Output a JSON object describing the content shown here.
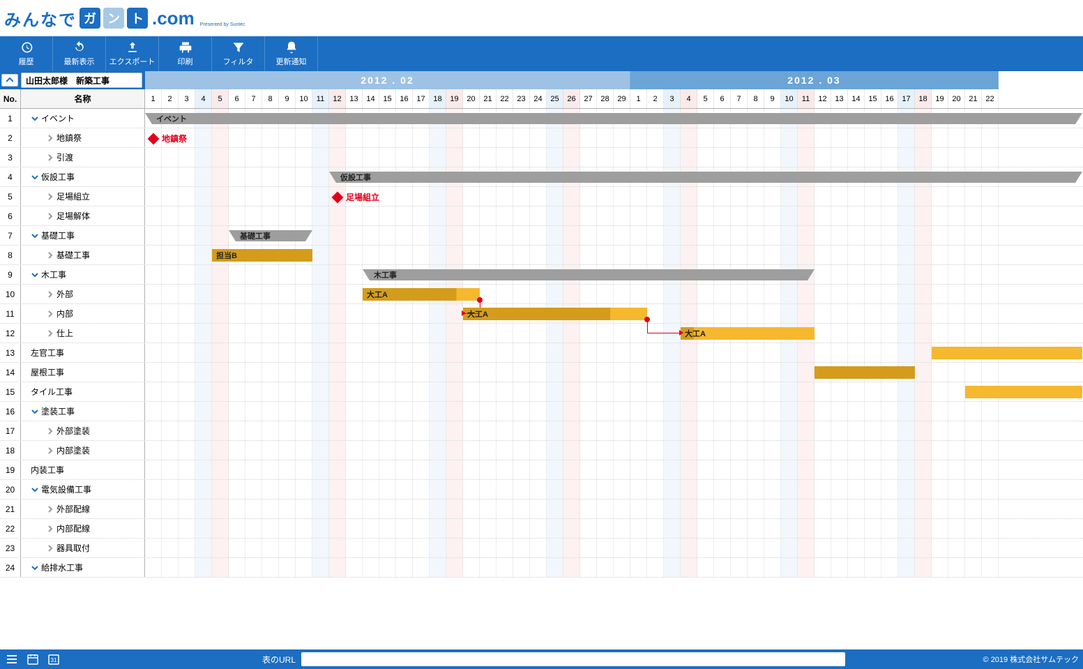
{
  "logo": {
    "text1": "みんなで",
    "ga": "ガ",
    "n": "ン",
    "to": "ト",
    "com": ".com",
    "pres": "Presented by Suntec"
  },
  "toolbar": {
    "history": "履歴",
    "refresh": "最新表示",
    "export": "エクスポート",
    "print": "印刷",
    "filter": "フィルタ",
    "notify": "更新通知"
  },
  "project_title": "山田太郎様　新築工事",
  "months": [
    {
      "label": "2012 . 02",
      "days": 29
    },
    {
      "label": "2012 . 03",
      "days": 22
    }
  ],
  "col_no": "No.",
  "col_name": "名称",
  "days": [
    {
      "n": 1,
      "t": "w"
    },
    {
      "n": 2,
      "t": "w"
    },
    {
      "n": 3,
      "t": "w"
    },
    {
      "n": 4,
      "t": "sat"
    },
    {
      "n": 5,
      "t": "sun"
    },
    {
      "n": 6,
      "t": "w"
    },
    {
      "n": 7,
      "t": "w"
    },
    {
      "n": 8,
      "t": "w"
    },
    {
      "n": 9,
      "t": "w"
    },
    {
      "n": 10,
      "t": "w"
    },
    {
      "n": 11,
      "t": "sat"
    },
    {
      "n": 12,
      "t": "sun"
    },
    {
      "n": 13,
      "t": "w"
    },
    {
      "n": 14,
      "t": "w"
    },
    {
      "n": 15,
      "t": "w"
    },
    {
      "n": 16,
      "t": "w"
    },
    {
      "n": 17,
      "t": "w"
    },
    {
      "n": 18,
      "t": "sat"
    },
    {
      "n": 19,
      "t": "sun"
    },
    {
      "n": 20,
      "t": "w"
    },
    {
      "n": 21,
      "t": "w"
    },
    {
      "n": 22,
      "t": "w"
    },
    {
      "n": 23,
      "t": "w"
    },
    {
      "n": 24,
      "t": "w"
    },
    {
      "n": 25,
      "t": "sat"
    },
    {
      "n": 26,
      "t": "sun"
    },
    {
      "n": 27,
      "t": "w"
    },
    {
      "n": 28,
      "t": "w"
    },
    {
      "n": 29,
      "t": "w"
    },
    {
      "n": 1,
      "t": "w"
    },
    {
      "n": 2,
      "t": "w"
    },
    {
      "n": 3,
      "t": "sat"
    },
    {
      "n": 4,
      "t": "sun"
    },
    {
      "n": 5,
      "t": "w"
    },
    {
      "n": 6,
      "t": "w"
    },
    {
      "n": 7,
      "t": "w"
    },
    {
      "n": 8,
      "t": "w"
    },
    {
      "n": 9,
      "t": "w"
    },
    {
      "n": 10,
      "t": "sat"
    },
    {
      "n": 11,
      "t": "sun"
    },
    {
      "n": 12,
      "t": "w"
    },
    {
      "n": 13,
      "t": "w"
    },
    {
      "n": 14,
      "t": "w"
    },
    {
      "n": 15,
      "t": "w"
    },
    {
      "n": 16,
      "t": "w"
    },
    {
      "n": 17,
      "t": "sat"
    },
    {
      "n": 18,
      "t": "sun"
    },
    {
      "n": 19,
      "t": "w"
    },
    {
      "n": 20,
      "t": "w"
    },
    {
      "n": 21,
      "t": "w"
    },
    {
      "n": 22,
      "t": "w"
    }
  ],
  "rows": [
    {
      "no": 1,
      "name": "イベント",
      "lvl": 1,
      "open": true,
      "gold": false
    },
    {
      "no": 2,
      "name": "地鎮祭",
      "lvl": 2,
      "open": false,
      "gold": true
    },
    {
      "no": 3,
      "name": "引渡",
      "lvl": 2,
      "open": false,
      "gold": true
    },
    {
      "no": 4,
      "name": "仮設工事",
      "lvl": 1,
      "open": true,
      "gold": false
    },
    {
      "no": 5,
      "name": "足場組立",
      "lvl": 2,
      "open": false,
      "gold": true
    },
    {
      "no": 6,
      "name": "足場解体",
      "lvl": 2,
      "open": false,
      "gold": true
    },
    {
      "no": 7,
      "name": "基礎工事",
      "lvl": 1,
      "open": true,
      "gold": false
    },
    {
      "no": 8,
      "name": "基礎工事",
      "lvl": 2,
      "open": false,
      "gold": true
    },
    {
      "no": 9,
      "name": "木工事",
      "lvl": 1,
      "open": true,
      "gold": false
    },
    {
      "no": 10,
      "name": "外部",
      "lvl": 2,
      "open": false,
      "gold": true
    },
    {
      "no": 11,
      "name": "内部",
      "lvl": 2,
      "open": false,
      "gold": true
    },
    {
      "no": 12,
      "name": "仕上",
      "lvl": 2,
      "open": false,
      "gold": true
    },
    {
      "no": 13,
      "name": "左官工事",
      "lvl": 1,
      "open": null,
      "gold": false
    },
    {
      "no": 14,
      "name": "屋根工事",
      "lvl": 1,
      "open": null,
      "gold": false
    },
    {
      "no": 15,
      "name": "タイル工事",
      "lvl": 1,
      "open": null,
      "gold": false
    },
    {
      "no": 16,
      "name": "塗装工事",
      "lvl": 1,
      "open": true,
      "gold": false
    },
    {
      "no": 17,
      "name": "外部塗装",
      "lvl": 2,
      "open": false,
      "gold": true
    },
    {
      "no": 18,
      "name": "内部塗装",
      "lvl": 2,
      "open": false,
      "gold": true
    },
    {
      "no": 19,
      "name": "内装工事",
      "lvl": 1,
      "open": null,
      "gold": false
    },
    {
      "no": 20,
      "name": "電気設備工事",
      "lvl": 1,
      "open": true,
      "gold": false
    },
    {
      "no": 21,
      "name": "外部配線",
      "lvl": 2,
      "open": false,
      "gold": true
    },
    {
      "no": 22,
      "name": "内部配線",
      "lvl": 2,
      "open": false,
      "gold": true
    },
    {
      "no": 23,
      "name": "器具取付",
      "lvl": 2,
      "open": false,
      "gold": true
    },
    {
      "no": 24,
      "name": "給排水工事",
      "lvl": 1,
      "open": true,
      "gold": false
    }
  ],
  "bars": [
    {
      "row": 1,
      "type": "group",
      "label": "イベント",
      "from": 1,
      "to": 56
    },
    {
      "row": 2,
      "type": "ms",
      "label": "地鎮祭",
      "at": 1
    },
    {
      "row": 4,
      "type": "group",
      "label": "仮設工事",
      "from": 12,
      "to": 56
    },
    {
      "row": 5,
      "type": "ms",
      "label": "足場組立",
      "at": 12
    },
    {
      "row": 7,
      "type": "group",
      "label": "基礎工事",
      "from": 6,
      "to": 10
    },
    {
      "row": 8,
      "type": "gold",
      "label": "担当B",
      "from": 5,
      "to": 10
    },
    {
      "row": 9,
      "type": "group",
      "label": "木工事",
      "from": 14,
      "to": 40
    },
    {
      "row": 10,
      "type": "gold-amber",
      "label": "大工A",
      "from": 14,
      "to": 20,
      "split": 80
    },
    {
      "row": 11,
      "type": "gold-amber",
      "label": "大工A",
      "from": 20,
      "to": 30,
      "split": 80
    },
    {
      "row": 12,
      "type": "gold-amber",
      "label": "大工A",
      "from": 33,
      "to": 40,
      "split": 10
    },
    {
      "row": 13,
      "type": "amber",
      "label": "",
      "from": 48,
      "to": 56
    },
    {
      "row": 14,
      "type": "gold",
      "label": "",
      "from": 41,
      "to": 46
    },
    {
      "row": 15,
      "type": "amber",
      "label": "",
      "from": 50,
      "to": 56
    }
  ],
  "links": [
    {
      "fromRow": 10,
      "fromDay": 20,
      "toRow": 11,
      "toDay": 20
    },
    {
      "fromRow": 11,
      "fromDay": 30,
      "toRow": 12,
      "toDay": 33
    }
  ],
  "footer": {
    "url_label": "表のURL",
    "copyright": "© 2019 株式会社サムテック"
  }
}
